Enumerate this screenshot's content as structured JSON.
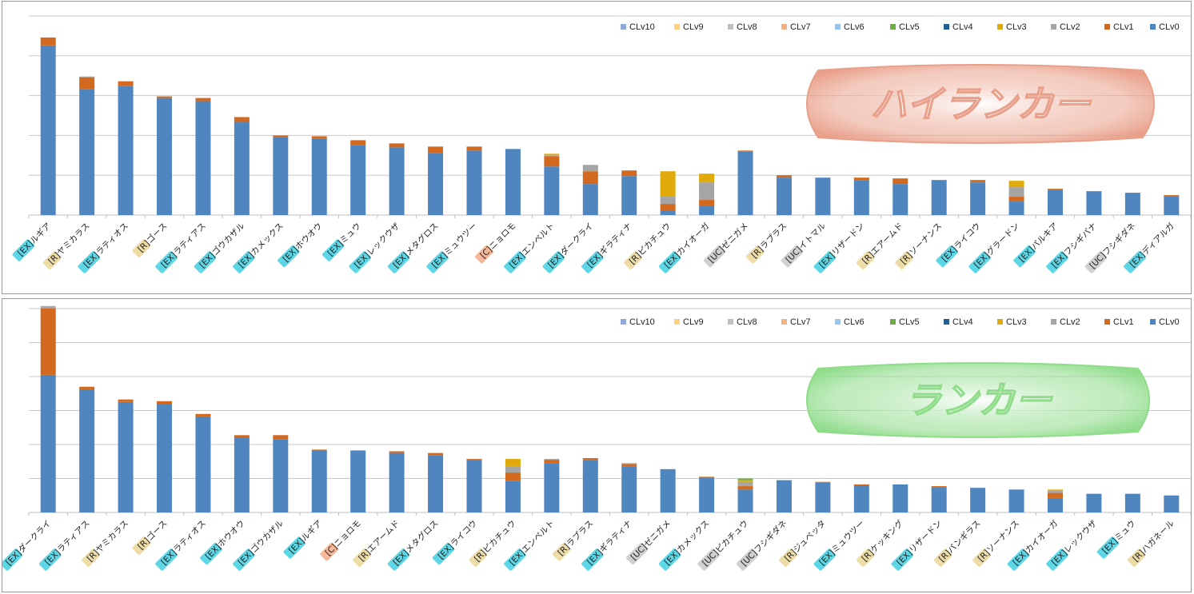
{
  "chart_data": [
    {
      "type": "bar",
      "stacked": true,
      "title": "",
      "banner_label": "ハイランカー",
      "banner_color": "#e9a08a",
      "yticks_shown": false,
      "grid": true,
      "legend_placement": "top-right",
      "ylim": [
        0,
        250
      ],
      "legend": [
        "CLv10",
        "CLv9",
        "CLv8",
        "CLv7",
        "CLv6",
        "CLv5",
        "CLv4",
        "CLv3",
        "CLv2",
        "CLv1",
        "CLv0"
      ],
      "categories": [
        {
          "rarity": "EX",
          "name": "ルギア"
        },
        {
          "rarity": "R",
          "name": "ヤミカラス"
        },
        {
          "rarity": "EX",
          "name": "ラティオス"
        },
        {
          "rarity": "R",
          "name": "ゴース"
        },
        {
          "rarity": "EX",
          "name": "ラティアス"
        },
        {
          "rarity": "EX",
          "name": "ゴウカザル"
        },
        {
          "rarity": "EX",
          "name": "カメックス"
        },
        {
          "rarity": "EX",
          "name": "ホウオウ"
        },
        {
          "rarity": "EX",
          "name": "ミュウ"
        },
        {
          "rarity": "EX",
          "name": "レックウザ"
        },
        {
          "rarity": "EX",
          "name": "メタグロス"
        },
        {
          "rarity": "EX",
          "name": "ミュウツー"
        },
        {
          "rarity": "C",
          "name": "ニョロモ"
        },
        {
          "rarity": "EX",
          "name": "エンペルト"
        },
        {
          "rarity": "EX",
          "name": "ダークライ"
        },
        {
          "rarity": "EX",
          "name": "ギラティナ"
        },
        {
          "rarity": "R",
          "name": "ピカチュウ"
        },
        {
          "rarity": "EX",
          "name": "カイオーガ"
        },
        {
          "rarity": "UC",
          "name": "ゼニガメ"
        },
        {
          "rarity": "R",
          "name": "ラプラス"
        },
        {
          "rarity": "UC",
          "name": "イトマル"
        },
        {
          "rarity": "EX",
          "name": "リザードン"
        },
        {
          "rarity": "R",
          "name": "エアームド"
        },
        {
          "rarity": "R",
          "name": "ソーナンス"
        },
        {
          "rarity": "EX",
          "name": "ライコウ"
        },
        {
          "rarity": "EX",
          "name": "グラードン"
        },
        {
          "rarity": "EX",
          "name": "パルキア"
        },
        {
          "rarity": "EX",
          "name": "フシギバナ"
        },
        {
          "rarity": "UC",
          "name": "フシギダネ"
        },
        {
          "rarity": "EX",
          "name": "ディアルガ"
        }
      ],
      "series": [
        {
          "name": "CLv0",
          "values": [
            213,
            158,
            162,
            147,
            143,
            117,
            98,
            96,
            88,
            85,
            78,
            81,
            83,
            61,
            39,
            49,
            6,
            11,
            80,
            47,
            47,
            44,
            39,
            44,
            41,
            17,
            32,
            30,
            28,
            24
          ]
        },
        {
          "name": "CLv1",
          "values": [
            10,
            15,
            6,
            2,
            4,
            6,
            2,
            3,
            6,
            5,
            8,
            5,
            0,
            13,
            16,
            7,
            8,
            8,
            1,
            3,
            0,
            3,
            7,
            0,
            3,
            6,
            1,
            0,
            0,
            1
          ]
        },
        {
          "name": "CLv2",
          "values": [
            0,
            1,
            0,
            0,
            0,
            0,
            0,
            0,
            0,
            0,
            0,
            0,
            0,
            1,
            8,
            0,
            10,
            22,
            0,
            0,
            0,
            0,
            0,
            0,
            0,
            12,
            0,
            0,
            0,
            0
          ]
        },
        {
          "name": "CLv3",
          "values": [
            0,
            0,
            0,
            0,
            0,
            0,
            0,
            0,
            0,
            0,
            0,
            0,
            0,
            2,
            0,
            0,
            31,
            11,
            0,
            0,
            0,
            0,
            0,
            0,
            0,
            8,
            0,
            0,
            0,
            0
          ]
        },
        {
          "name": "CLv4",
          "values": [
            0,
            0,
            0,
            0,
            0,
            0,
            0,
            0,
            0,
            0,
            0,
            0,
            0,
            0,
            0,
            0,
            0,
            0,
            0,
            0,
            0,
            0,
            0,
            0,
            0,
            0,
            0,
            0,
            0,
            0
          ]
        },
        {
          "name": "CLv5",
          "values": [
            0,
            0,
            0,
            0,
            0,
            0,
            0,
            0,
            0,
            0,
            0,
            0,
            0,
            0,
            0,
            0,
            0,
            0,
            0,
            0,
            0,
            0,
            0,
            0,
            0,
            0,
            0,
            0,
            0,
            0
          ]
        },
        {
          "name": "CLv6",
          "values": [
            0,
            0,
            0,
            0,
            0,
            0,
            0,
            0,
            0,
            0,
            0,
            0,
            0,
            0,
            0,
            0,
            0,
            0,
            0,
            0,
            0,
            0,
            0,
            0,
            0,
            0,
            0,
            0,
            0,
            0
          ]
        },
        {
          "name": "CLv7",
          "values": [
            0,
            0,
            0,
            0,
            0,
            0,
            0,
            0,
            0,
            0,
            0,
            0,
            0,
            0,
            0,
            0,
            0,
            0,
            0,
            0,
            0,
            0,
            0,
            0,
            0,
            0,
            0,
            0,
            0,
            0
          ]
        },
        {
          "name": "CLv8",
          "values": [
            0,
            0,
            0,
            0,
            0,
            0,
            0,
            0,
            0,
            0,
            0,
            0,
            0,
            0,
            0,
            0,
            0,
            0,
            0,
            0,
            0,
            0,
            0,
            0,
            0,
            0,
            0,
            0,
            0,
            0
          ]
        },
        {
          "name": "CLv9",
          "values": [
            0,
            0,
            0,
            0,
            0,
            0,
            0,
            0,
            0,
            0,
            0,
            0,
            0,
            0,
            0,
            0,
            0,
            0,
            0,
            0,
            0,
            0,
            0,
            0,
            0,
            0,
            0,
            0,
            0,
            0
          ]
        },
        {
          "name": "CLv10",
          "values": [
            0,
            0,
            0,
            0,
            0,
            0,
            0,
            0,
            0,
            0,
            0,
            0,
            0,
            0,
            0,
            0,
            0,
            0,
            0,
            0,
            0,
            0,
            0,
            0,
            0,
            0,
            0,
            0,
            0,
            0
          ]
        }
      ]
    },
    {
      "type": "bar",
      "stacked": true,
      "title": "",
      "banner_label": "ランカー",
      "banner_color": "#8fdc8a",
      "yticks_shown": false,
      "grid": true,
      "legend_placement": "top-right",
      "ylim": [
        0,
        240
      ],
      "legend": [
        "CLv10",
        "CLv9",
        "CLv8",
        "CLv7",
        "CLv6",
        "CLv5",
        "CLv4",
        "CLv3",
        "CLv2",
        "CLv1",
        "CLv0"
      ],
      "categories": [
        {
          "rarity": "EX",
          "name": "ダークライ"
        },
        {
          "rarity": "EX",
          "name": "ラティアス"
        },
        {
          "rarity": "R",
          "name": "ヤミカラス"
        },
        {
          "rarity": "R",
          "name": "ゴース"
        },
        {
          "rarity": "EX",
          "name": "ラティオス"
        },
        {
          "rarity": "EX",
          "name": "ホウオウ"
        },
        {
          "rarity": "EX",
          "name": "ゴウカザル"
        },
        {
          "rarity": "EX",
          "name": "ルギア"
        },
        {
          "rarity": "C",
          "name": "ニョロモ"
        },
        {
          "rarity": "R",
          "name": "エアームド"
        },
        {
          "rarity": "EX",
          "name": "メタグロス"
        },
        {
          "rarity": "EX",
          "name": "ライコウ"
        },
        {
          "rarity": "R",
          "name": "ピカチュウ"
        },
        {
          "rarity": "EX",
          "name": "エンペルト"
        },
        {
          "rarity": "R",
          "name": "ラプラス"
        },
        {
          "rarity": "EX",
          "name": "ギラティナ"
        },
        {
          "rarity": "UC",
          "name": "ゼニガメ"
        },
        {
          "rarity": "EX",
          "name": "カメックス"
        },
        {
          "rarity": "UC",
          "name": "ピカチュウ"
        },
        {
          "rarity": "UC",
          "name": "フシギダネ"
        },
        {
          "rarity": "R",
          "name": "ジュペッタ"
        },
        {
          "rarity": "EX",
          "name": "ミュウツー"
        },
        {
          "rarity": "R",
          "name": "ケッキング"
        },
        {
          "rarity": "EX",
          "name": "リザードン"
        },
        {
          "rarity": "R",
          "name": "バンギラス"
        },
        {
          "rarity": "R",
          "name": "ソーナンス"
        },
        {
          "rarity": "EX",
          "name": "カイオーガ"
        },
        {
          "rarity": "EX",
          "name": "レックウザ"
        },
        {
          "rarity": "EX",
          "name": "ミュウ"
        },
        {
          "rarity": "R",
          "name": "ハガネール"
        }
      ],
      "series": [
        {
          "name": "CLv0",
          "values": [
            162,
            145,
            130,
            128,
            113,
            88,
            86,
            73,
            73,
            70,
            67,
            62,
            37,
            58,
            62,
            54,
            51,
            41,
            27,
            38,
            35,
            32,
            33,
            30,
            29,
            27,
            17,
            22,
            22,
            20
          ]
        },
        {
          "name": "CLv1",
          "values": [
            78,
            3,
            3,
            3,
            3,
            3,
            5,
            1,
            0,
            2,
            3,
            1,
            10,
            4,
            2,
            3,
            0,
            1,
            4,
            0,
            1,
            1,
            0,
            1,
            0,
            0,
            6,
            0,
            0,
            0
          ]
        },
        {
          "name": "CLv2",
          "values": [
            3,
            0,
            0,
            0,
            0,
            0,
            0,
            0,
            0,
            0,
            0,
            0,
            7,
            1,
            0,
            1,
            0,
            0,
            5,
            0,
            0,
            0,
            0,
            0,
            0,
            0,
            3,
            0,
            0,
            0
          ]
        },
        {
          "name": "CLv3",
          "values": [
            0,
            0,
            0,
            0,
            0,
            0,
            0,
            0,
            0,
            0,
            0,
            0,
            9,
            0,
            0,
            0,
            0,
            0,
            2,
            0,
            0,
            0,
            0,
            0,
            0,
            0,
            1,
            0,
            0,
            0
          ]
        },
        {
          "name": "CLv4",
          "values": [
            0,
            0,
            0,
            0,
            0,
            0,
            0,
            0,
            0,
            0,
            0,
            0,
            0,
            0,
            0,
            0,
            0,
            0,
            0,
            0,
            0,
            0,
            0,
            0,
            0,
            0,
            0,
            0,
            0,
            0
          ]
        },
        {
          "name": "CLv5",
          "values": [
            0,
            0,
            0,
            0,
            0,
            0,
            0,
            0,
            0,
            0,
            0,
            0,
            0,
            0,
            0,
            0,
            0,
            0,
            2,
            0,
            0,
            0,
            0,
            0,
            0,
            0,
            0,
            0,
            0,
            0
          ]
        },
        {
          "name": "CLv6",
          "values": [
            0,
            0,
            0,
            0,
            0,
            0,
            0,
            0,
            0,
            0,
            0,
            0,
            0,
            0,
            0,
            0,
            0,
            0,
            0,
            0,
            0,
            0,
            0,
            0,
            0,
            0,
            0,
            0,
            0,
            0
          ]
        },
        {
          "name": "CLv7",
          "values": [
            0,
            0,
            0,
            0,
            0,
            0,
            0,
            0,
            0,
            0,
            0,
            0,
            0,
            0,
            0,
            0,
            0,
            0,
            0,
            0,
            0,
            0,
            0,
            0,
            0,
            0,
            0,
            0,
            0,
            0
          ]
        },
        {
          "name": "CLv8",
          "values": [
            0,
            0,
            0,
            0,
            0,
            0,
            0,
            0,
            0,
            0,
            0,
            0,
            0,
            0,
            0,
            0,
            0,
            0,
            0,
            0,
            0,
            0,
            0,
            0,
            0,
            0,
            0,
            0,
            0,
            0
          ]
        },
        {
          "name": "CLv9",
          "values": [
            0,
            0,
            0,
            0,
            0,
            0,
            0,
            0,
            0,
            0,
            0,
            0,
            0,
            0,
            0,
            0,
            0,
            0,
            0,
            0,
            0,
            0,
            0,
            0,
            0,
            0,
            0,
            0,
            0,
            0
          ]
        },
        {
          "name": "CLv10",
          "values": [
            0,
            0,
            0,
            0,
            0,
            0,
            0,
            0,
            0,
            0,
            0,
            0,
            0,
            0,
            0,
            0,
            0,
            0,
            0,
            0,
            0,
            0,
            0,
            0,
            0,
            0,
            0,
            0,
            0,
            0
          ]
        }
      ]
    }
  ],
  "colors": {
    "CLv10": "#8ea9d6",
    "CLv9": "#ffd27f",
    "CLv8": "#bfbfbf",
    "CLv7": "#f4b183",
    "CLv6": "#9dc3e6",
    "CLv5": "#70ad47",
    "CLv4": "#255e91",
    "CLv3": "#e0aa0a",
    "CLv2": "#a5a5a5",
    "CLv1": "#d2691e",
    "CLv0": "#4f86c0"
  },
  "rarity_colors": {
    "EX": "#5dd6e6",
    "R": "#eddca6",
    "C": "#f5b89a",
    "UC": "#d0d0d0"
  }
}
